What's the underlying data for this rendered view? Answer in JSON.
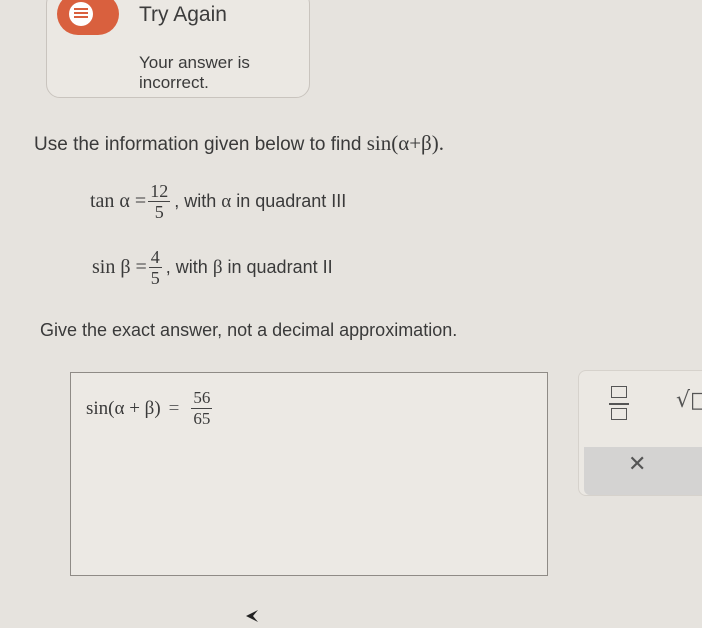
{
  "feedback": {
    "title": "Try Again",
    "message": "Your answer is incorrect.",
    "status_color": "#d9603e"
  },
  "problem": {
    "instruction_text": "Use the information given below to find",
    "instruction_math": "sin(α+β).",
    "given": [
      {
        "lhs": "tan α =",
        "numerator": "12",
        "denominator": "5",
        "condition_prefix": ", with",
        "symbol": "α",
        "condition_suffix": "in quadrant III"
      },
      {
        "lhs": "sin β =",
        "numerator": "4",
        "denominator": "5",
        "condition_prefix": ", with",
        "symbol": "β",
        "condition_suffix": "in quadrant II"
      }
    ],
    "note": "Give the exact answer, not a decimal approximation."
  },
  "answer": {
    "lhs": "sin(α + β)",
    "equals": "=",
    "numerator": "56",
    "denominator": "65"
  },
  "toolbar": {
    "fraction_icon": "fraction-icon",
    "sqrt_icon": "square-root-icon",
    "sqrt_glyph": "√□",
    "clear_icon": "close-icon",
    "clear_glyph": "✕"
  }
}
